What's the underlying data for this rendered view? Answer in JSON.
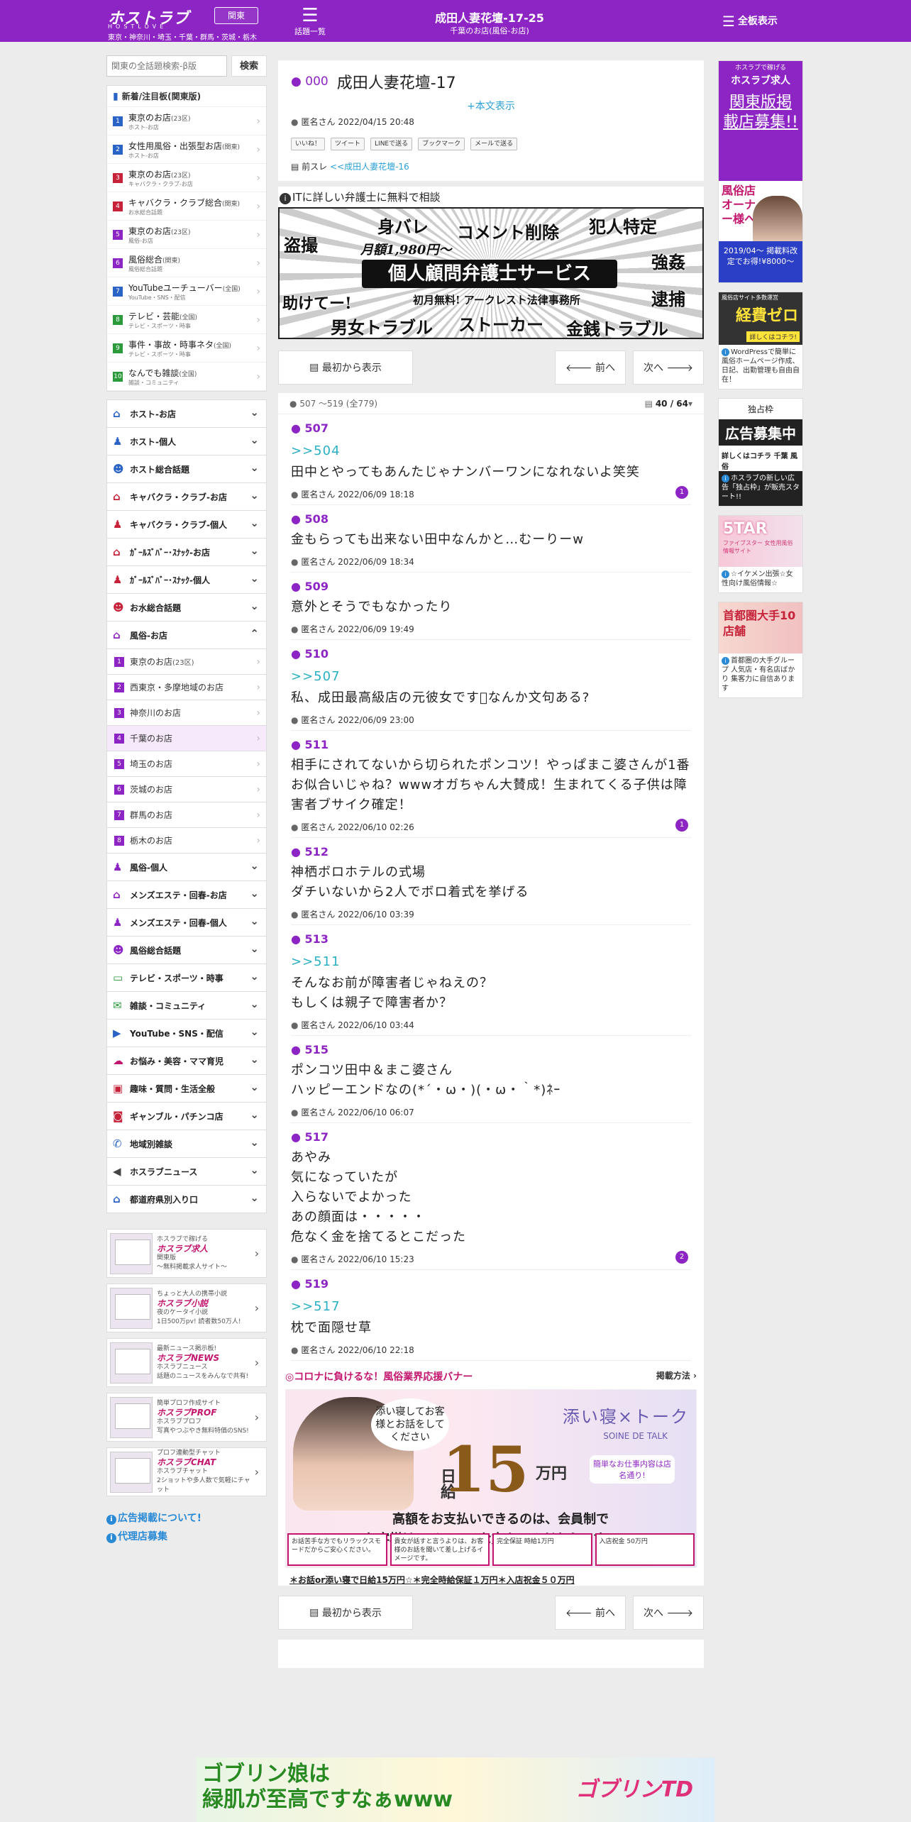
{
  "header": {
    "logo": "ホストラブ",
    "logo_sub": "HOSTLOVE",
    "region_button": "関東",
    "region_line": "東京・神奈川・埼玉・千葉・群馬・茨城・栃木",
    "topics_label": "話題一覧",
    "title": "成田人妻花壇-17-25",
    "subtitle": "千葉のお店(風俗-お店)",
    "all_boards": "全板表示"
  },
  "sidebar": {
    "search_placeholder": "関東の全話題検索-β版",
    "search_button": "検索",
    "ranking_title": "新着/注目板(関東版)",
    "ranking": [
      {
        "num": "1",
        "color": "#2a63c6",
        "name": "東京のお店",
        "count": "(23区)",
        "desc": "ホスト-お店"
      },
      {
        "num": "2",
        "color": "#2a63c6",
        "name": "女性用風俗・出張型お店",
        "count": "(関東)",
        "desc": "ホスト-お店"
      },
      {
        "num": "3",
        "color": "#c6233a",
        "name": "東京のお店",
        "count": "(23区)",
        "desc": "キャバクラ・クラブ-お店"
      },
      {
        "num": "4",
        "color": "#c6233a",
        "name": "キャバクラ・クラブ総合",
        "count": "(関東)",
        "desc": "お水総合話題"
      },
      {
        "num": "5",
        "color": "#8d25c4",
        "name": "東京のお店",
        "count": "(23区)",
        "desc": "風俗-お店"
      },
      {
        "num": "6",
        "color": "#8d25c4",
        "name": "風俗総合",
        "count": "(関東)",
        "desc": "風俗総合話題"
      },
      {
        "num": "7",
        "color": "#2a63c6",
        "name": "YouTubeユーチューバー",
        "count": "(全国)",
        "desc": "YouTube・SNS・配信"
      },
      {
        "num": "8",
        "color": "#2a9a3a",
        "name": "テレビ・芸能",
        "count": "(全国)",
        "desc": "テレビ・スポーツ・時事"
      },
      {
        "num": "9",
        "color": "#2a9a3a",
        "name": "事件・事故・時事ネタ",
        "count": "(全国)",
        "desc": "テレビ・スポーツ・時事"
      },
      {
        "num": "10",
        "color": "#2a9a3a",
        "name": "なんでも雑談",
        "count": "(全国)",
        "desc": "雑談・コミュニティ"
      }
    ],
    "categories_a": [
      {
        "label": "ホスト-お店",
        "icon": "⌂",
        "color": "#2a63c6",
        "chev": "⌄"
      },
      {
        "label": "ホスト-個人",
        "icon": "♟",
        "color": "#2a63c6",
        "chev": "⌄"
      },
      {
        "label": "ホスト総合話題",
        "icon": "☻",
        "color": "#2a63c6",
        "chev": "⌄"
      },
      {
        "label": "キャバクラ・クラブ-お店",
        "icon": "⌂",
        "color": "#c6233a",
        "chev": "⌄"
      },
      {
        "label": "キャバクラ・クラブ-個人",
        "icon": "♟",
        "color": "#c6233a",
        "chev": "⌄"
      },
      {
        "label": "ｶﾞｰﾙｽﾞﾊﾞｰ･ｽﾅｯｸ-お店",
        "icon": "⌂",
        "color": "#c6233a",
        "chev": "⌄"
      },
      {
        "label": "ｶﾞｰﾙｽﾞﾊﾞｰ･ｽﾅｯｸ-個人",
        "icon": "♟",
        "color": "#c6233a",
        "chev": "⌄"
      },
      {
        "label": "お水総合話題",
        "icon": "☻",
        "color": "#c6233a",
        "chev": "⌄"
      },
      {
        "label": "風俗-お店",
        "icon": "⌂",
        "color": "#8d25c4",
        "chev": "⌃"
      }
    ],
    "subitems": [
      {
        "num": "1",
        "label": "東京のお店",
        "count": "(23区)"
      },
      {
        "num": "2",
        "label": "西東京・多摩地域のお店",
        "count": ""
      },
      {
        "num": "3",
        "label": "神奈川のお店",
        "count": ""
      },
      {
        "num": "4",
        "label": "千葉のお店",
        "count": ""
      },
      {
        "num": "5",
        "label": "埼玉のお店",
        "count": ""
      },
      {
        "num": "6",
        "label": "茨城のお店",
        "count": ""
      },
      {
        "num": "7",
        "label": "群馬のお店",
        "count": ""
      },
      {
        "num": "8",
        "label": "栃木のお店",
        "count": ""
      }
    ],
    "categories_b": [
      {
        "label": "風俗-個人",
        "icon": "♟",
        "color": "#8d25c4",
        "chev": "⌄"
      },
      {
        "label": "メンズエステ・回春-お店",
        "icon": "⌂",
        "color": "#8d25c4",
        "chev": "⌄"
      },
      {
        "label": "メンズエステ・回春-個人",
        "icon": "♟",
        "color": "#8d25c4",
        "chev": "⌄"
      },
      {
        "label": "風俗総合話題",
        "icon": "☻",
        "color": "#8d25c4",
        "chev": "⌄"
      },
      {
        "label": "テレビ・スポーツ・時事",
        "icon": "▭",
        "color": "#2a9a3a",
        "chev": "⌄"
      },
      {
        "label": "雑談・コミュニティ",
        "icon": "✉",
        "color": "#2a9a3a",
        "chev": "⌄"
      },
      {
        "label": "YouTube・SNS・配信",
        "icon": "▶",
        "color": "#2a63c6",
        "chev": "⌄"
      },
      {
        "label": "お悩み・美容・ママ育児",
        "icon": "☁",
        "color": "#c2166e",
        "chev": "⌄"
      },
      {
        "label": "趣味・質問・生活全般",
        "icon": "▣",
        "color": "#c6233a",
        "chev": "⌄"
      },
      {
        "label": "ギャンブル・パチンコ店",
        "icon": "◙",
        "color": "#c6233a",
        "chev": "⌄"
      },
      {
        "label": "地域別雑談",
        "icon": "✆",
        "color": "#2a63c6",
        "chev": "⌄"
      },
      {
        "label": "ホスラブニュース",
        "icon": "◀",
        "color": "#444444",
        "chev": "⌄"
      },
      {
        "label": "都道府県別入り口",
        "icon": "⌂",
        "color": "#2a63c6",
        "chev": "⌄"
      }
    ],
    "promos": [
      {
        "tag": "ホスラブで稼げる",
        "title": "ホスラブ求人",
        "line1": "関東版",
        "line2": "〜無料掲載求人サイト〜"
      },
      {
        "tag": "ちょっと大人の携帯小説",
        "title": "ホスラブ小説",
        "line1": "夜のケータイ小説",
        "line2": "1日500万pv! 読者数50万人!"
      },
      {
        "tag": "最新ニュース掲示板!",
        "title": "ホスラブNEWS",
        "line1": "ホスラブニュース",
        "line2": "話題のニュースをみんなで共有!"
      },
      {
        "tag": "簡単プロフ作成サイト",
        "title": "ホスラブPROF",
        "line1": "ホスラブプロフ",
        "line2": "写真やつぶやき無料特価のSNS!"
      },
      {
        "tag": "プロフ連動型チャット",
        "title": "ホスラブCHAT",
        "line1": "ホスラブチャット",
        "line2": "2ショットや多人数で気軽にチャット"
      }
    ],
    "links": [
      "広告掲載について!",
      "代理店募集"
    ]
  },
  "thread": {
    "number": "000",
    "title": "成田人妻花壇-17",
    "honbun_link": "+本文表示",
    "author": "匿名さん",
    "date": "2022/04/15 20:48",
    "shares": [
      "いいね！",
      "ツイート",
      "LINEで送る",
      "ブックマーク",
      "メールで送る"
    ],
    "prev_label": "前スレ",
    "prev_link": "<<成田人妻花壇-16"
  },
  "ad_lawyer": {
    "title": "ITに詳しい弁護士に無料で相談",
    "words": [
      "身バレ",
      "コメント削除",
      "犯人特定",
      "盗撮",
      "月額1,980円〜",
      "強姦",
      "個人顧問弁護士サービス",
      "助けてー!",
      "初月無料! アークレスト法律事務所",
      "逮捕",
      "男女トラブル",
      "ストーカー",
      "金銭トラブル"
    ]
  },
  "nav": {
    "first": "最初から表示",
    "prev": "前へ",
    "next": "次へ"
  },
  "pager": {
    "range": "507 〜519",
    "total": "(全779)",
    "page": "40 / 64"
  },
  "posts": [
    {
      "num": "507",
      "ref": ">>504",
      "body": [
        "田中とやってもあんたじゃナンバーワンになれないよ笑笑"
      ],
      "author": "匿名さん",
      "date": "2022/06/09 18:18",
      "replies": "1"
    },
    {
      "num": "508",
      "ref": "",
      "body": [
        "金もらっても出来ない田中なんかと…むーりーw"
      ],
      "author": "匿名さん",
      "date": "2022/06/09 18:34",
      "replies": ""
    },
    {
      "num": "509",
      "ref": "",
      "body": [
        "意外とそうでもなかったり"
      ],
      "author": "匿名さん",
      "date": "2022/06/09 19:49",
      "replies": ""
    },
    {
      "num": "510",
      "ref": ">>507",
      "body": [
        "私、成田最高級店の元彼女です󾭛なんか文句ある?"
      ],
      "author": "匿名さん",
      "date": "2022/06/09 23:00",
      "replies": ""
    },
    {
      "num": "511",
      "ref": "",
      "body": [
        "相手にされてないから切られたポンコツ！やっぱまこ婆さんが1番お似合いじゃね？wwwオガちゃん大賛成！生まれてくる子供は障害者ブサイク確定！"
      ],
      "author": "匿名さん",
      "date": "2022/06/10 02:26",
      "replies": "1"
    },
    {
      "num": "512",
      "ref": "",
      "body": [
        "神栖ボロホテルの式場",
        "ダチいないから2人でボロ着式を挙げる"
      ],
      "author": "匿名さん",
      "date": "2022/06/10 03:39",
      "replies": ""
    },
    {
      "num": "513",
      "ref": ">>511",
      "body": [
        "そんなお前が障害者じゃねえの？",
        "もしくは親子で障害者か？"
      ],
      "author": "匿名さん",
      "date": "2022/06/10 03:44",
      "replies": ""
    },
    {
      "num": "515",
      "ref": "",
      "body": [
        "ポンコツ田中＆まこ婆さん",
        "ハッピーエンドなの(*´・ω・)(・ω・｀*)ﾈｰ"
      ],
      "author": "匿名さん",
      "date": "2022/06/10 06:07",
      "replies": ""
    },
    {
      "num": "517",
      "ref": "",
      "body": [
        "あやみ",
        "気になっていたが",
        "入らないでよかった",
        "あの顔面は・・・・・",
        "危なく金を捨てるとこだった"
      ],
      "author": "匿名さん",
      "date": "2022/06/10 15:23",
      "replies": "2"
    },
    {
      "num": "519",
      "ref": ">>517",
      "body": [
        "枕で面隠せ草"
      ],
      "author": "匿名さん",
      "date": "2022/06/10 22:18",
      "replies": ""
    }
  ],
  "corona": {
    "title": "◎コロナに負けるな！風俗業界応援バナー",
    "method": "掲載方法 ›",
    "bubble": "添い寝してお客様とお話をしてください",
    "daily": "日給",
    "amount": "15",
    "unit": "万円",
    "brand": "添い寝×トーク",
    "brand_en": "SOINE DE TALK",
    "note": "簡単なお仕事内容は店名通り!",
    "msg1": "高額をお支払いできるのは、会員制で",
    "msg2": "お客様はハイレベルな方々のみだからです",
    "chips": [
      "お話苦手な方でもリラックスモードだからご安心ください。",
      "貴女が話すと言うよりは、お客様のお話を聞いて差し上げるイメージです。",
      "完全保証 時給1万円",
      "入店祝金 50万円"
    ],
    "caption": "＊お話or添い寝で日給15万円☆＊完全時給保証１万円＊入店祝金５０万円"
  },
  "right_ads": [
    {
      "top": "ホスラブで稼げる",
      "brand": "ホスラブ求人",
      "big": "関東版掲載店募集!!",
      "sub": "風俗店オーナー様へ",
      "foot": "2019/04〜 掲載料改定でお得!¥8000〜",
      "cap": ""
    },
    {
      "top": "風俗店サイト多数運営",
      "brand": "経費ゼロ",
      "big": "",
      "sub": "詳しくはコチラ!",
      "foot": "",
      "cap": "WordPressで簡単に風俗ホームページ作成、日記、出勤管理も自由自在！"
    },
    {
      "top": "独占枠",
      "brand": "広告募集中",
      "big": "",
      "sub": "詳しくはコチラ 千葉 風俗",
      "foot": "",
      "cap": "ホスラブの新しい広告「独占枠」が販売スタート!!"
    },
    {
      "top": "",
      "brand": "5TAR",
      "big": "",
      "sub": "ファイブスター 女性用風俗情報サイト",
      "foot": "",
      "cap": "☆イケメン出張☆女性向け風俗情報☆"
    },
    {
      "top": "",
      "brand": "首都圏大手10店舗",
      "big": "",
      "sub": "",
      "foot": "",
      "cap": "首都圏の大手グループ 人気店・有名店ばかり 集客力に自信あります"
    }
  ],
  "bottom_ad": {
    "line1": "ゴブリン娘は",
    "line2": "緑肌が至高ですなぁwww",
    "right": "ゴブリンTD"
  },
  "colors": {
    "brand": "#8d25c4",
    "link": "#2aa0d6",
    "pink": "#c2166e"
  }
}
